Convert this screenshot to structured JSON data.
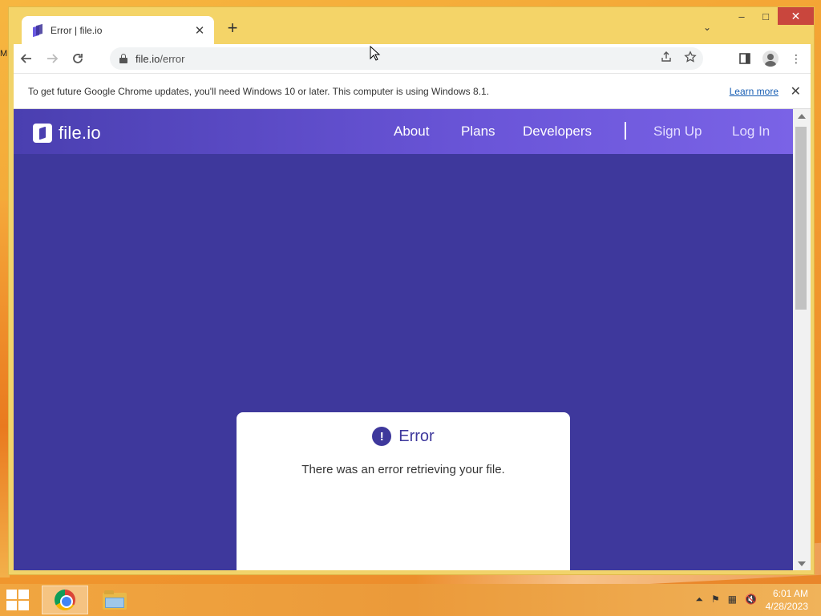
{
  "desktop": {
    "edge_text": "M"
  },
  "browser": {
    "tab_title": "Error | file.io",
    "new_tab_icon": "plus-icon",
    "window_controls": {
      "minimize": "–",
      "maximize": "□",
      "close": "✕"
    },
    "url_host": "file.io",
    "url_path": "/error",
    "infobar": {
      "message": "To get future Google Chrome updates, you'll need Windows 10 or later. This computer is using Windows 8.1.",
      "link": "Learn more"
    }
  },
  "site": {
    "brand": "file.io",
    "nav": {
      "about": "About",
      "plans": "Plans",
      "developers": "Developers",
      "signup": "Sign Up",
      "login": "Log In"
    },
    "error_card": {
      "title": "Error",
      "message": "There was an error retrieving your file."
    }
  },
  "taskbar": {
    "clock_time": "6:01 AM",
    "clock_date": "4/28/2023"
  },
  "colors": {
    "site_bg": "#3e389c",
    "header": "#6a55d8",
    "taskbar": "#f1a640"
  }
}
